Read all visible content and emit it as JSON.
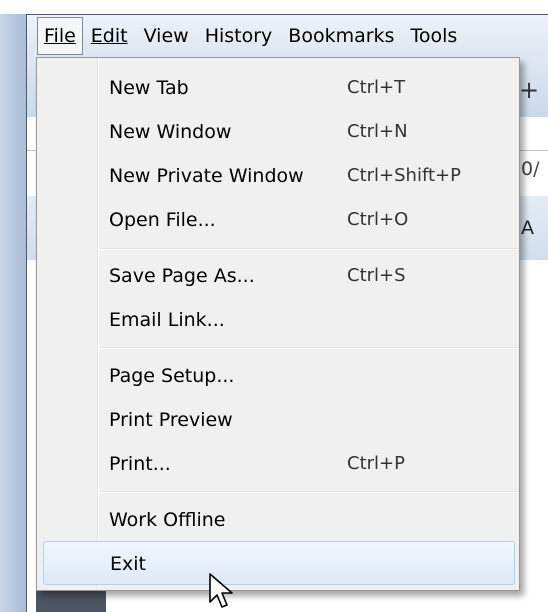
{
  "menubar": {
    "items": [
      {
        "label": "File"
      },
      {
        "label": "Edit"
      },
      {
        "label": "View"
      },
      {
        "label": "History"
      },
      {
        "label": "Bookmarks"
      },
      {
        "label": "Tools"
      }
    ]
  },
  "background": {
    "plus": "+",
    "url_fragment": "0/",
    "row_letter": "A"
  },
  "file_menu": {
    "items": [
      {
        "label": "New Tab",
        "shortcut": "Ctrl+T"
      },
      {
        "label": "New Window",
        "shortcut": "Ctrl+N"
      },
      {
        "label": "New Private Window",
        "shortcut": "Ctrl+Shift+P"
      },
      {
        "label": "Open File...",
        "shortcut": "Ctrl+O"
      },
      {
        "label": "Save Page As...",
        "shortcut": "Ctrl+S"
      },
      {
        "label": "Email Link...",
        "shortcut": ""
      },
      {
        "label": "Page Setup...",
        "shortcut": ""
      },
      {
        "label": "Print Preview",
        "shortcut": ""
      },
      {
        "label": "Print...",
        "shortcut": "Ctrl+P"
      },
      {
        "label": "Work Offline",
        "shortcut": ""
      },
      {
        "label": "Exit",
        "shortcut": ""
      }
    ],
    "highlighted_item": "Exit"
  },
  "cursor": {
    "icon": "arrow-pointer-icon"
  }
}
